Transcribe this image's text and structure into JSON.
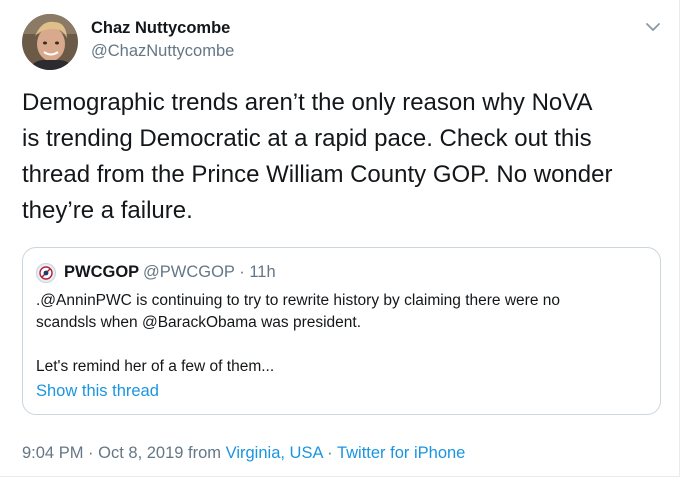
{
  "author": {
    "name": "Chaz Nuttycombe",
    "handle": "@ChazNuttycombe"
  },
  "tweet": {
    "lines": [
      "Demographic trends aren’t the only reason why NoVA",
      "is trending Democratic at a rapid pace. Check out this",
      "thread from the Prince William County GOP. No wonder",
      "they’re a failure."
    ]
  },
  "quoted": {
    "name": "PWCGOP",
    "handle": "@PWCGOP",
    "separator": "·",
    "time": "11h",
    "lines": [
      ".@AnninPWC is continuing to try to rewrite history by claiming there were no",
      "scandsls when @BarackObama was president.",
      "",
      "Let's remind her of a few of them..."
    ],
    "show_thread": "Show this thread"
  },
  "footer": {
    "time": "9:04 PM",
    "sep1": "·",
    "date": "Oct 8, 2019",
    "from": "from",
    "location": "Virginia, USA",
    "sep2": "·",
    "source": "Twitter for iPhone"
  },
  "icons": {
    "caret": "chevron-down-icon",
    "quoted_avatar": "gop-logo-icon"
  },
  "colors": {
    "link": "#1b95e0",
    "secondary_text": "#657786",
    "primary_text": "#14171a",
    "border": "#ccd6dd"
  }
}
